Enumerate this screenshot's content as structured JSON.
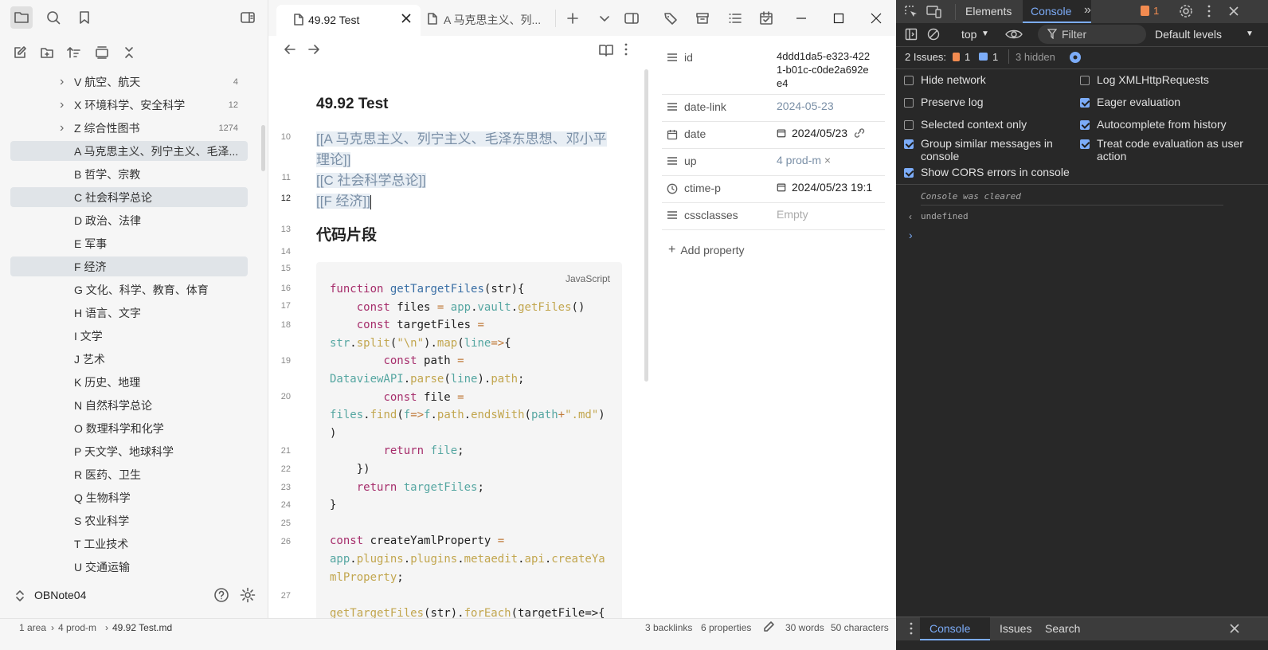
{
  "sidebar": {
    "tree": [
      {
        "label": "V 航空、航天",
        "count": "4",
        "chevron": true,
        "hl": false
      },
      {
        "label": "X 环境科学、安全科学",
        "count": "12",
        "chevron": true,
        "hl": false
      },
      {
        "label": "Z 综合性图书",
        "count": "1274",
        "chevron": true,
        "hl": false
      },
      {
        "label": "A 马克思主义、列宁主义、毛泽...",
        "count": "",
        "chevron": false,
        "hl": true
      },
      {
        "label": "B 哲学、宗教",
        "count": "",
        "chevron": false,
        "hl": false
      },
      {
        "label": "C 社会科学总论",
        "count": "",
        "chevron": false,
        "hl": true
      },
      {
        "label": "D 政治、法律",
        "count": "",
        "chevron": false,
        "hl": false
      },
      {
        "label": "E 军事",
        "count": "",
        "chevron": false,
        "hl": false
      },
      {
        "label": "F 经济",
        "count": "",
        "chevron": false,
        "hl": true
      },
      {
        "label": "G 文化、科学、教育、体育",
        "count": "",
        "chevron": false,
        "hl": false
      },
      {
        "label": "H 语言、文字",
        "count": "",
        "chevron": false,
        "hl": false
      },
      {
        "label": "I 文学",
        "count": "",
        "chevron": false,
        "hl": false
      },
      {
        "label": "J 艺术",
        "count": "",
        "chevron": false,
        "hl": false
      },
      {
        "label": "K 历史、地理",
        "count": "",
        "chevron": false,
        "hl": false
      },
      {
        "label": "N 自然科学总论",
        "count": "",
        "chevron": false,
        "hl": false
      },
      {
        "label": "O 数理科学和化学",
        "count": "",
        "chevron": false,
        "hl": false
      },
      {
        "label": "P 天文学、地球科学",
        "count": "",
        "chevron": false,
        "hl": false
      },
      {
        "label": "R 医药、卫生",
        "count": "",
        "chevron": false,
        "hl": false
      },
      {
        "label": "Q 生物科学",
        "count": "",
        "chevron": false,
        "hl": false
      },
      {
        "label": "S 农业科学",
        "count": "",
        "chevron": false,
        "hl": false
      },
      {
        "label": "T 工业技术",
        "count": "",
        "chevron": false,
        "hl": false
      },
      {
        "label": "U 交通运输",
        "count": "",
        "chevron": false,
        "hl": false
      }
    ],
    "vault_name": "OBNote04"
  },
  "tabs": {
    "active": "49.92 Test",
    "inactive": "A 马克思主义、列..."
  },
  "editor": {
    "title": "49.92 Test",
    "links": [
      "[[A 马克思主义、列宁主义、毛泽东思想、邓小平",
      "理论]]",
      "[[C 社会科学总论]]",
      "[[F 经济]]"
    ],
    "heading": "代码片段",
    "code_lang": "JavaScript",
    "line_numbers": {
      "l10": "10",
      "l11": "11",
      "l12": "12",
      "l13": "13",
      "l14": "14",
      "l15": "15",
      "l16": "16",
      "l17": "17",
      "l18": "18",
      "l19": "19",
      "l20": "20",
      "l21": "21",
      "l22": "22",
      "l23": "23",
      "l24": "24",
      "l25": "25",
      "l26": "26",
      "l27": "27"
    }
  },
  "properties": [
    {
      "key": "id",
      "value": "4ddd1da5-e323-4221-b01c-c0de2a692ee4",
      "icon": "list-icon"
    },
    {
      "key": "date-link",
      "value": "2024-05-23",
      "icon": "list-icon"
    },
    {
      "key": "date",
      "value": "2024/05/23",
      "icon": "calendar-icon"
    },
    {
      "key": "up",
      "value": "4 prod-m",
      "icon": "list-icon"
    },
    {
      "key": "ctime-p",
      "value": "2024/05/23  19:1",
      "icon": "clock-icon"
    },
    {
      "key": "cssclasses",
      "value": "Empty",
      "icon": "list-icon"
    }
  ],
  "add_property": "Add property",
  "statusbar": {
    "crumbs": [
      "1 area",
      "4 prod-m",
      "49.92 Test.md"
    ],
    "backlinks": "3 backlinks",
    "props": "6 properties",
    "words": "30 words",
    "chars": "50 characters"
  },
  "devtools": {
    "tabs": [
      "Elements",
      "Console"
    ],
    "active_tab": "Console",
    "issue_badge": "1",
    "context": "top",
    "filter_placeholder": "Filter",
    "levels": "Default levels",
    "issues_label": "2 Issues:",
    "issues_warn": "1",
    "issues_info": "1",
    "hidden": "3 hidden",
    "options_left": [
      {
        "label": "Hide network",
        "on": false
      },
      {
        "label": "Preserve log",
        "on": false
      },
      {
        "label": "Selected context only",
        "on": false
      },
      {
        "label": "Group similar messages in console",
        "on": true
      },
      {
        "label": "Show CORS errors in console",
        "on": true
      }
    ],
    "options_right": [
      {
        "label": "Log XMLHttpRequests",
        "on": false
      },
      {
        "label": "Eager evaluation",
        "on": true
      },
      {
        "label": "Autocomplete from history",
        "on": true
      },
      {
        "label": "Treat code evaluation as user action",
        "on": true
      }
    ],
    "cleared": "Console was cleared",
    "undefined": "undefined",
    "drawer_tabs": [
      "Console",
      "Issues",
      "Search"
    ]
  },
  "colors": {
    "accent": "#7cacf8",
    "link": "#7a8fa6"
  }
}
